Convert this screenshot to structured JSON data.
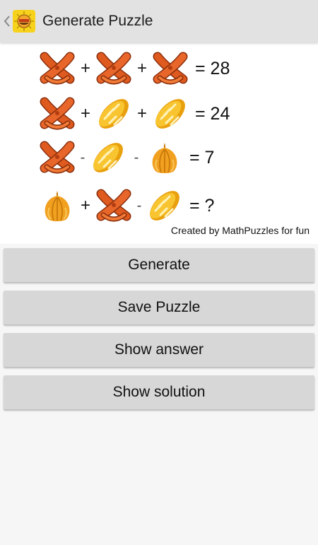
{
  "header": {
    "title": "Generate Puzzle"
  },
  "puzzle": {
    "rows": [
      {
        "items": [
          "sausage-icon",
          "+",
          "sausage-icon",
          "+",
          "sausage-icon"
        ],
        "result": "= 28"
      },
      {
        "items": [
          "sausage-icon",
          "+",
          "bread-icon",
          "+",
          "bread-icon"
        ],
        "result": "= 24"
      },
      {
        "items": [
          "sausage-icon",
          "-",
          "bread-icon",
          "-",
          "garlic-icon"
        ],
        "result": "= 7"
      },
      {
        "items": [
          "garlic-icon",
          "+",
          "sausage-icon",
          "-",
          "bread-icon"
        ],
        "result": "= ?"
      }
    ],
    "row1": {
      "op1": "+",
      "op2": "+",
      "result": "= 28"
    },
    "row2": {
      "op1": "+",
      "op2": "+",
      "result": "= 24"
    },
    "row3": {
      "op1": "-",
      "op2": "-",
      "result": "= 7"
    },
    "row4": {
      "op1": "+",
      "op2": "-",
      "result": "= ?"
    },
    "credit": "Created by MathPuzzles for fun"
  },
  "buttons": {
    "generate": "Generate",
    "save": "Save Puzzle",
    "show_answer": "Show answer",
    "show_solution": "Show solution"
  },
  "colors": {
    "sausage": "#d9541c",
    "bread": "#f4b41a",
    "garlic": "#f0a020",
    "button_bg": "#d7d7d7",
    "appbar_bg": "#e2e2e2"
  }
}
